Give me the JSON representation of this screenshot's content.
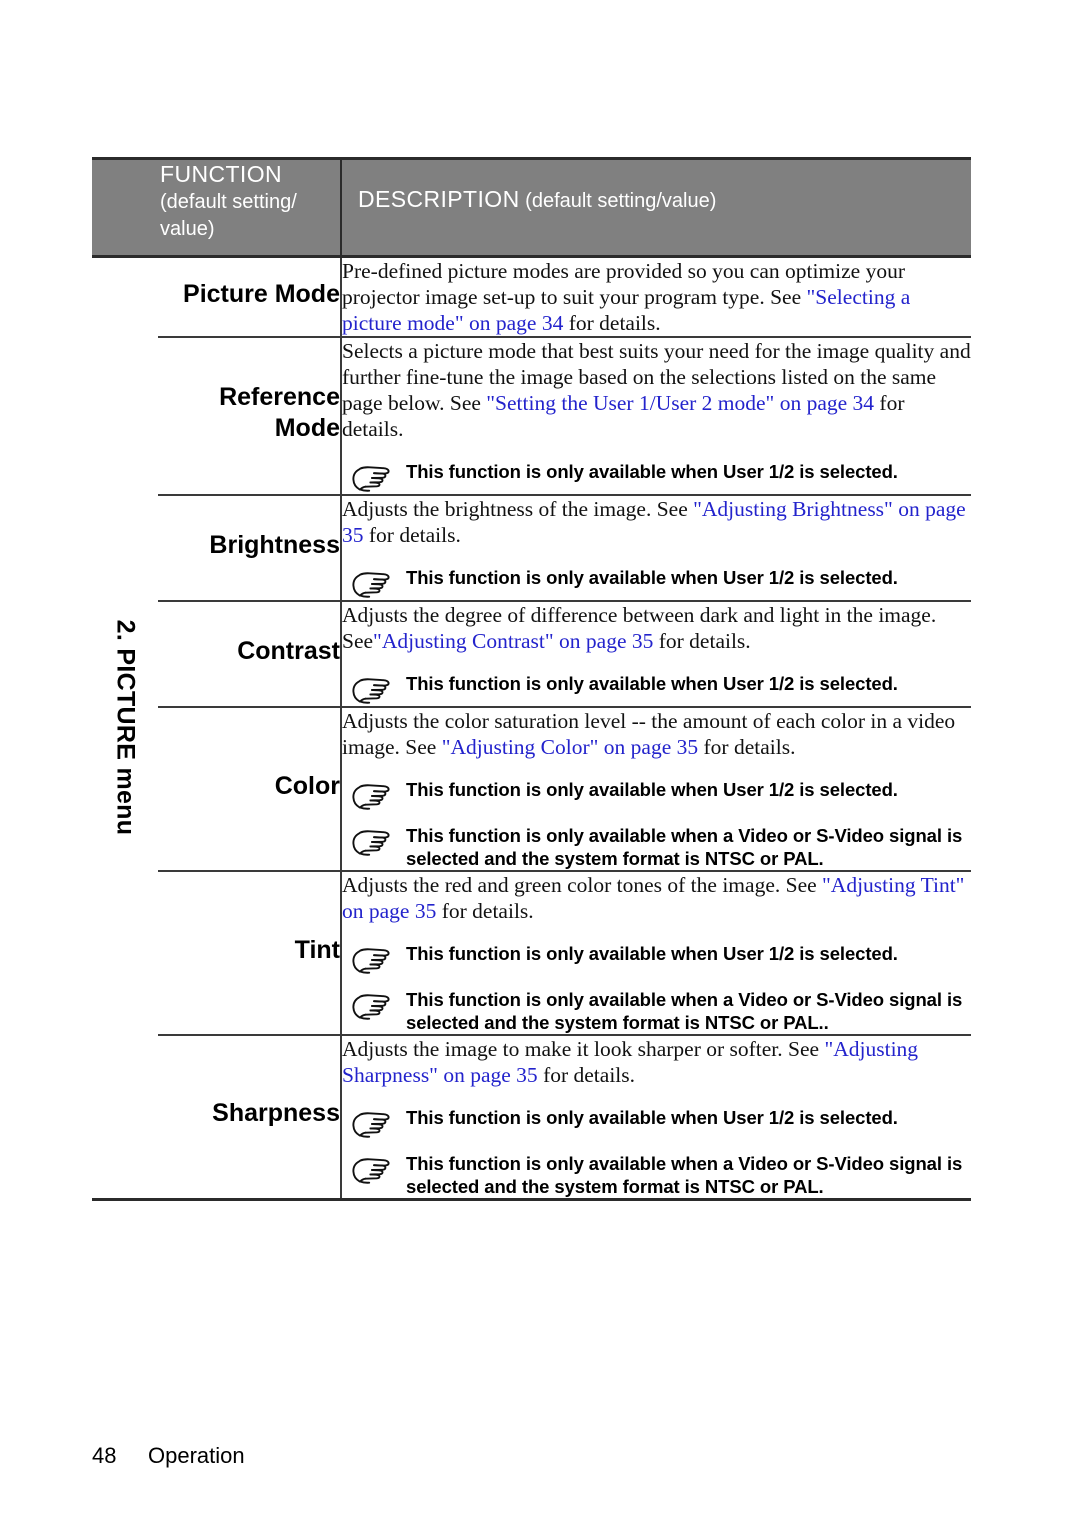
{
  "document": {
    "section_label": "2. PICTURE menu",
    "footer": {
      "page_number": "48",
      "section": "Operation"
    },
    "colors": {
      "header_band": "#808080",
      "link": "#2323cc",
      "text": "#000000"
    }
  },
  "table": {
    "header": {
      "function_title": "FUNCTION",
      "function_subtitle": "(default setting/ value)",
      "description_title": "DESCRIPTION",
      "description_subtitle": "(default setting/value)"
    },
    "rows": [
      {
        "function": "Picture Mode",
        "description_parts": [
          {
            "text": "Pre-defined picture modes are provided so you can optimize your projector image set-up to suit your program type. See ",
            "link": false
          },
          {
            "text": "\"Selecting a picture mode\" on page 34",
            "link": true
          },
          {
            "text": " for details.",
            "link": false
          }
        ],
        "notes": []
      },
      {
        "function": "Reference Mode",
        "description_parts": [
          {
            "text": "Selects a picture mode that best suits your need for the image quality and further fine-tune the image based on the selections listed on the same page below. See ",
            "link": false
          },
          {
            "text": "\"Setting the User 1/User 2 mode\" on page 34",
            "link": true
          },
          {
            "text": " for details.",
            "link": false
          }
        ],
        "notes": [
          "This function is only available when User 1/2 is selected."
        ]
      },
      {
        "function": "Brightness",
        "description_parts": [
          {
            "text": "Adjusts the brightness of the image. See ",
            "link": false
          },
          {
            "text": "\"Adjusting Brightness\" on page 35",
            "link": true
          },
          {
            "text": " for details.",
            "link": false
          }
        ],
        "notes": [
          "This function is only available when User 1/2 is selected."
        ]
      },
      {
        "function": "Contrast",
        "description_parts": [
          {
            "text": "Adjusts the degree of difference between dark and light in the image. See",
            "link": false
          },
          {
            "text": "\"Adjusting Contrast\" on page 35",
            "link": true
          },
          {
            "text": " for details.",
            "link": false
          }
        ],
        "notes": [
          "This function is only available when User 1/2 is selected."
        ]
      },
      {
        "function": "Color",
        "description_parts": [
          {
            "text": "Adjusts the color saturation level -- the amount of each color in a video image. See ",
            "link": false
          },
          {
            "text": "\"Adjusting Color\" on page 35",
            "link": true
          },
          {
            "text": " for details.",
            "link": false
          }
        ],
        "notes": [
          "This function is only available when User 1/2 is selected.",
          "This function is only available when a Video or S-Video signal is selected and the system format is NTSC or PAL."
        ]
      },
      {
        "function": "Tint",
        "description_parts": [
          {
            "text": "Adjusts the red and green color tones of the image. See ",
            "link": false
          },
          {
            "text": "\"Adjusting Tint\" on page 35",
            "link": true
          },
          {
            "text": " for details.",
            "link": false
          }
        ],
        "notes": [
          "This function is only available when User 1/2 is selected.",
          "This function is only available when a Video or S-Video signal is selected and the system format is NTSC or PAL.."
        ]
      },
      {
        "function": "Sharpness",
        "description_parts": [
          {
            "text": "Adjusts the image to make it look sharper or softer. See ",
            "link": false
          },
          {
            "text": "\"Adjusting Sharpness\" on page 35",
            "link": true
          },
          {
            "text": " for details.",
            "link": false
          }
        ],
        "notes": [
          "This function is only available when User 1/2 is selected.",
          "This function is only available when a Video or S-Video signal is selected and the system format is NTSC or PAL."
        ]
      }
    ]
  }
}
